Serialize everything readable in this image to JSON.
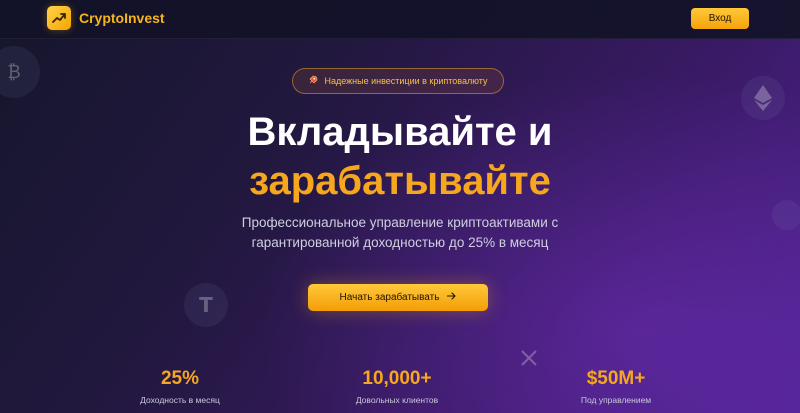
{
  "header": {
    "app_name": "CryptoInvest",
    "logo_icon": "trending-up-icon",
    "login_label": "Вход"
  },
  "hero": {
    "badge_text": "Надежные инвестиции в криптовалюту",
    "badge_icon": "rocket-icon",
    "headline_line1": "Вкладывайте и",
    "headline_line2": "зарабатывайте",
    "subtitle_line1": "Профессиональное управление криптоактивами с",
    "subtitle_line2": "гарантированной доходностью до 25% в месяц",
    "cta_label": "Начать зарабатывать",
    "cta_icon": "arrow-right-icon"
  },
  "stats": [
    {
      "value": "25%",
      "label": "Доходность в месяц"
    },
    {
      "value": "10,000+",
      "label": "Довольных клиентов"
    },
    {
      "value": "$50M+",
      "label": "Под управлением"
    }
  ],
  "decor": {
    "coins": [
      "bitcoin-icon",
      "ethereum-icon",
      "tether-icon",
      "coin-icon",
      "xrp-icon"
    ]
  },
  "colors": {
    "accent": "#f6a71e",
    "button": "#ffc93a",
    "background_dark": "#15162b",
    "background_purple": "#4f2390"
  }
}
